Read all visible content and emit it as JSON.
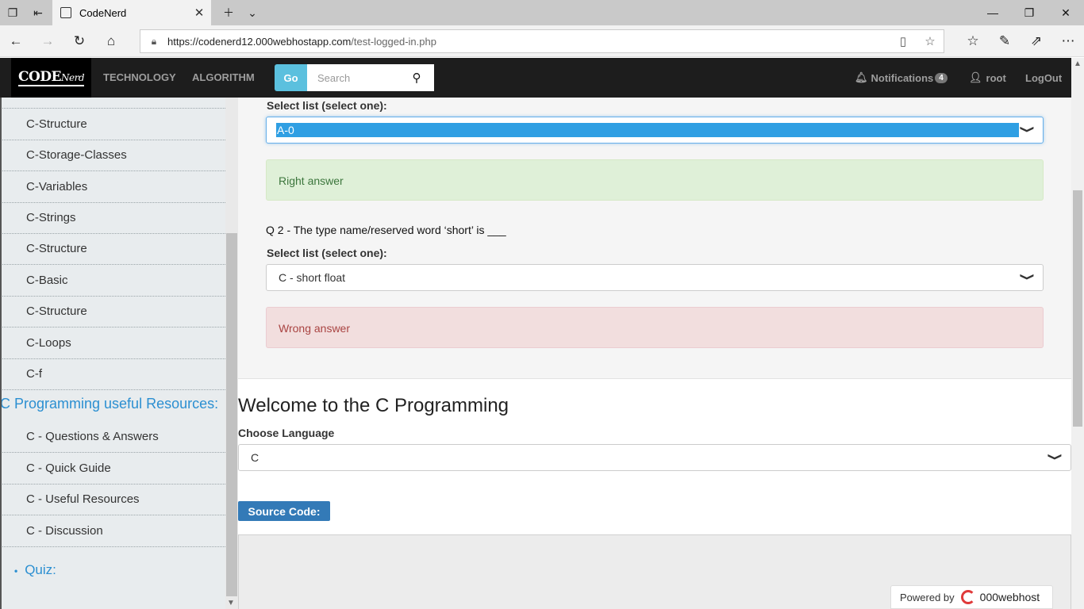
{
  "browser": {
    "tab_title": "CodeNerd",
    "url_host": "https://codenerd12.000webhostapp.com",
    "url_path": "/test-logged-in.php"
  },
  "nav": {
    "logo_code": "CODE",
    "logo_nerd": "Nerd",
    "links": [
      "TECHNOLOGY",
      "ALGORITHM"
    ],
    "go_label": "Go",
    "search_placeholder": "Search",
    "notifications_label": "Notifications",
    "notifications_count": "4",
    "user_label": "root",
    "logout_label": "LogOut"
  },
  "sidebar": {
    "items": [
      "C-Structure",
      "C-Storage-Classes",
      "C-Variables",
      "C-Strings",
      "C-Structure",
      "C-Basic",
      "C-Structure",
      "C-Loops",
      "C-f"
    ],
    "resources_heading": "C Programming useful Resources:",
    "resources": [
      "C - Questions & Answers",
      "C - Quick Guide",
      "C - Useful Resources",
      "C - Discussion"
    ],
    "quiz_label": "Quiz:"
  },
  "quiz": {
    "q1_select_label": "Select list (select one):",
    "q1_selected": "A-0",
    "q1_result": "Right answer",
    "q2_text": "Q 2 - The type name/reserved word ‘short’ is ___",
    "q2_select_label": "Select list (select one):",
    "q2_selected": "C - short float",
    "q2_result": "Wrong answer"
  },
  "main": {
    "welcome": "Welcome to the C Programming",
    "choose_language_label": "Choose Language",
    "language_selected": "C",
    "source_code_label": "Source Code:",
    "powered_by": "Powered by",
    "host_brand": "000webhost"
  }
}
